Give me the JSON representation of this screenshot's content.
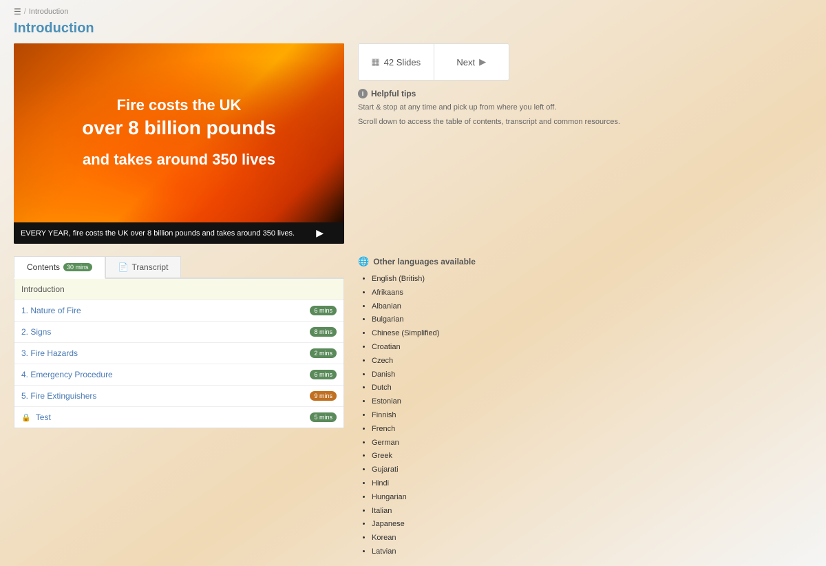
{
  "breadcrumb": {
    "icon": "☰",
    "separator": "/",
    "current": "Introduction"
  },
  "page": {
    "title": "Introduction"
  },
  "fire_slide": {
    "line1": "Fire costs the UK",
    "line2": "over 8 billion pounds",
    "line3": "and takes around 350 lives",
    "caption": "EVERY YEAR, fire costs the UK over 8 billion pounds and takes around 350 lives."
  },
  "nav": {
    "slides_icon": "▦",
    "slides_label": "42 Slides",
    "next_label": "Next",
    "next_icon": "▶"
  },
  "helpful_tips": {
    "title": "Helpful tips",
    "tip1": "Start & stop at any time and pick up from where you left off.",
    "tip2": "Scroll down to access the table of contents, transcript and common resources."
  },
  "tabs": {
    "contents_label": "Contents",
    "contents_badge": "30 mins",
    "transcript_label": "Transcript",
    "transcript_icon": "📄"
  },
  "toc": {
    "items": [
      {
        "label": "Introduction",
        "highlight": true,
        "badge": null,
        "locked": false
      },
      {
        "label": "1. Nature of Fire",
        "highlight": false,
        "badge": "6 mins",
        "badge_color": "green",
        "locked": false
      },
      {
        "label": "2. Signs",
        "highlight": false,
        "badge": "8 mins",
        "badge_color": "green",
        "locked": false
      },
      {
        "label": "3. Fire Hazards",
        "highlight": false,
        "badge": "2 mins",
        "badge_color": "green",
        "locked": false
      },
      {
        "label": "4. Emergency Procedure",
        "highlight": false,
        "badge": "6 mins",
        "badge_color": "green",
        "locked": false
      },
      {
        "label": "5. Fire Extinguishers",
        "highlight": false,
        "badge": "9 mins",
        "badge_color": "orange",
        "locked": false
      },
      {
        "label": "Test",
        "highlight": false,
        "badge": "5 mins",
        "badge_color": "green",
        "locked": true
      }
    ]
  },
  "languages": {
    "title": "Other languages available",
    "list": [
      "English (British)",
      "Afrikaans",
      "Albanian",
      "Bulgarian",
      "Chinese (Simplified)",
      "Croatian",
      "Czech",
      "Danish",
      "Dutch",
      "Estonian",
      "Finnish",
      "French",
      "German",
      "Greek",
      "Gujarati",
      "Hindi",
      "Hungarian",
      "Italian",
      "Japanese",
      "Korean",
      "Latvian"
    ]
  }
}
